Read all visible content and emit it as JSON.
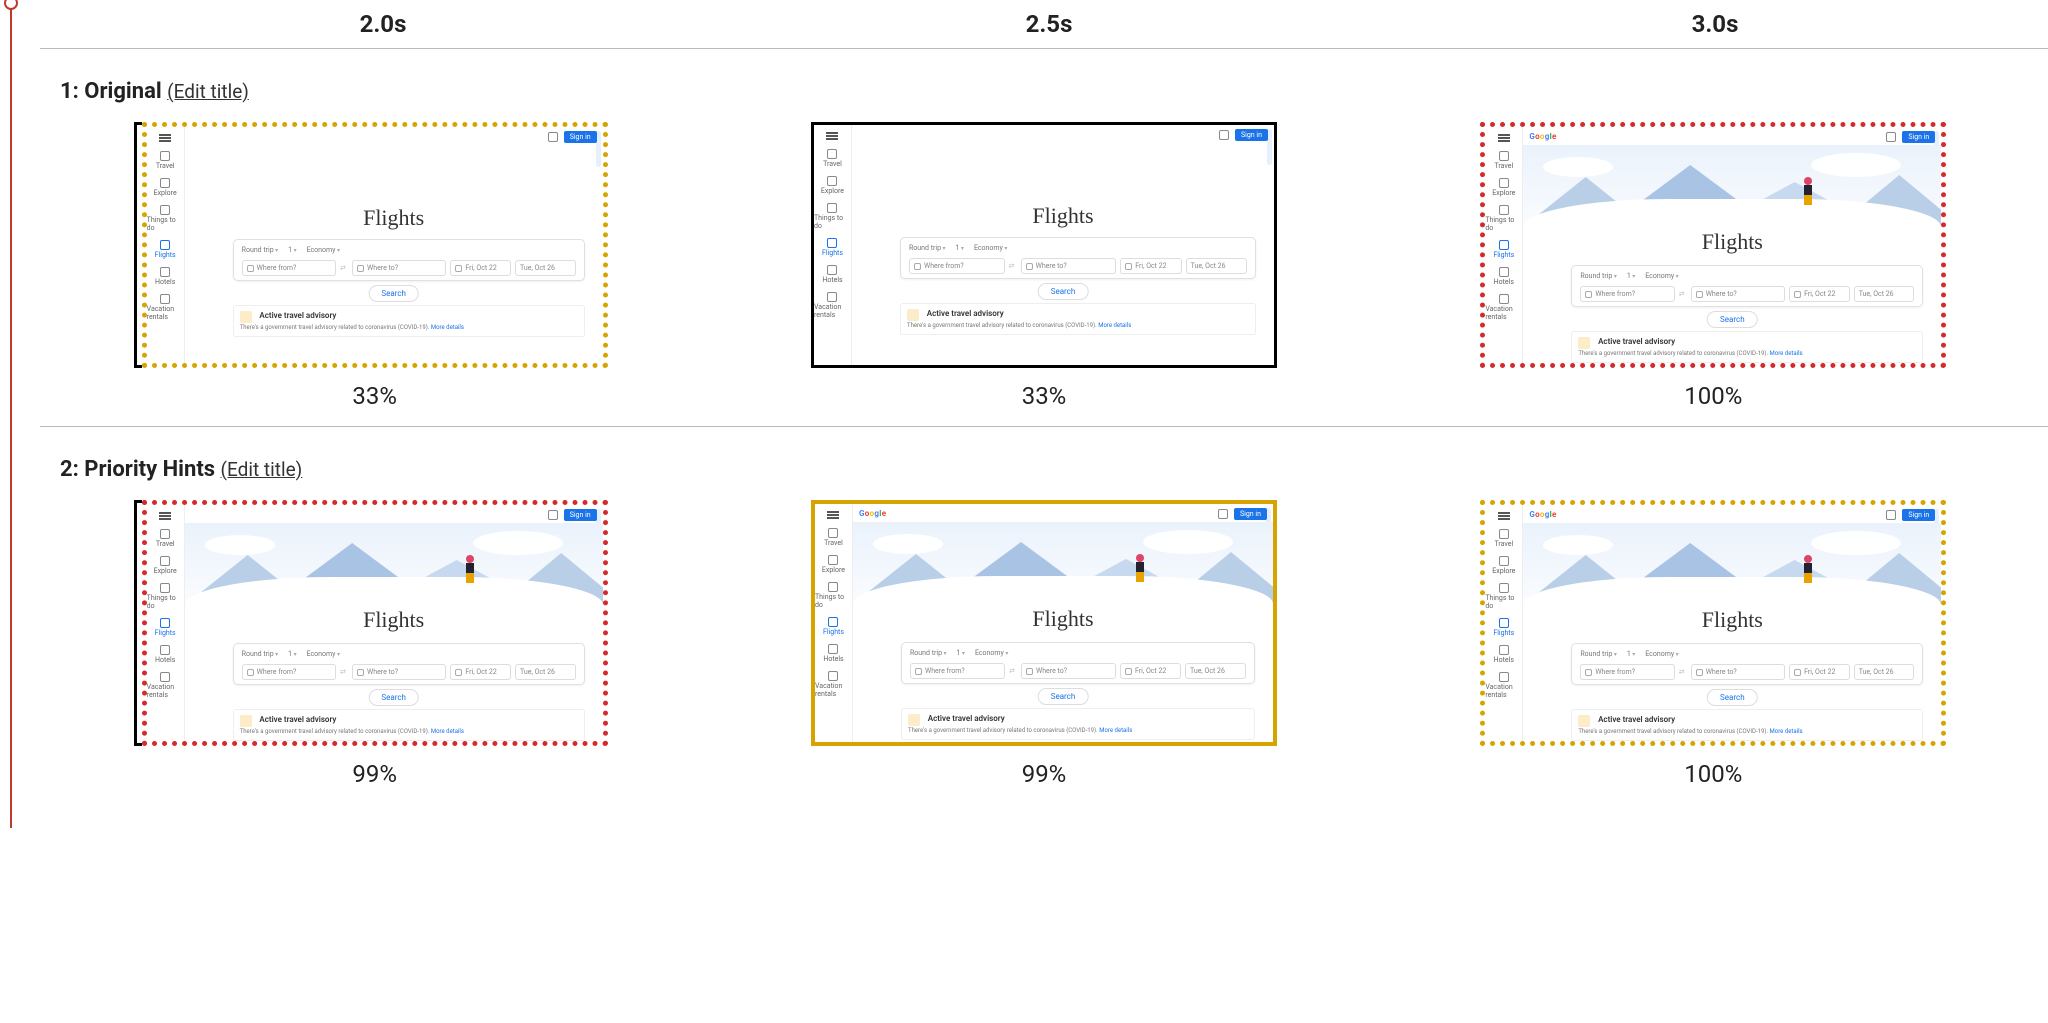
{
  "time_header": {
    "t1": "2.0s",
    "t2": "2.5s",
    "t3": "3.0s"
  },
  "rows": {
    "row1": {
      "number": "1:",
      "label": "Original",
      "edit": "(Edit title)",
      "frames": {
        "f1": {
          "pct": "33%",
          "border": "border-dotted-amber",
          "marker": true,
          "showHero": false,
          "showLogo": false
        },
        "f2": {
          "pct": "33%",
          "border": "border-solid-black",
          "marker": false,
          "showHero": false,
          "showLogo": false
        },
        "f3": {
          "pct": "100%",
          "border": "border-dotted-red",
          "marker": false,
          "showHero": true,
          "showLogo": true
        }
      }
    },
    "row2": {
      "number": "2:",
      "label": "Priority Hints",
      "edit": "(Edit title)",
      "frames": {
        "f1": {
          "pct": "99%",
          "border": "border-dotted-red",
          "marker": true,
          "showHero": true,
          "showLogo": false
        },
        "f2": {
          "pct": "99%",
          "border": "border-solid-amber",
          "marker": false,
          "showHero": true,
          "showLogo": true
        },
        "f3": {
          "pct": "100%",
          "border": "border-dotted-amber",
          "marker": false,
          "showHero": true,
          "showLogo": true
        }
      }
    }
  },
  "mini": {
    "logo": "Google",
    "signin": "Sign in",
    "title": "Flights",
    "sidebar": {
      "s1": "Travel",
      "s2": "Explore",
      "s3": "Things to do",
      "s4": "Flights",
      "s5": "Hotels",
      "s6": "Vacation rentals"
    },
    "opts": {
      "o1": "Round trip",
      "o2": "1",
      "o3": "Economy"
    },
    "fields": {
      "from": "Where from?",
      "to": "Where to?",
      "date1": "Fri, Oct 22",
      "date2": "Tue, Oct 26"
    },
    "search": "Search",
    "advisory": {
      "title": "Active travel advisory",
      "body": "There's a government travel advisory related to coronavirus (COVID-19).",
      "link": "More details"
    }
  }
}
